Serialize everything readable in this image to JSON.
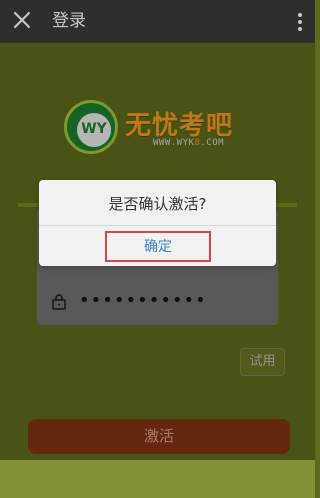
{
  "header": {
    "title": "登录"
  },
  "logo": {
    "brand_cn": "无忧考吧",
    "brand_wy": "WY",
    "url_prefix": "WWW.WYK",
    "url_accent": "8",
    "url_suffix": ".COM"
  },
  "login": {
    "password_mask": "•••••••••••"
  },
  "buttons": {
    "trial": "试用",
    "activate": "激活"
  },
  "dialog": {
    "message": "是否确认激活?",
    "confirm": "确定"
  },
  "colors": {
    "topbar": "#3b3b3b",
    "background_green": "#5f6b1d",
    "accent_orange": "#f39c1c",
    "dialog_bg": "#f2f2f2",
    "confirm_blue": "#3b87c9",
    "confirm_border_red": "#d44a4a",
    "activate_button": "#7f3312"
  },
  "icons": {
    "back": "close-icon",
    "menu": "more-vertical-icon",
    "lock": "lock-icon"
  }
}
